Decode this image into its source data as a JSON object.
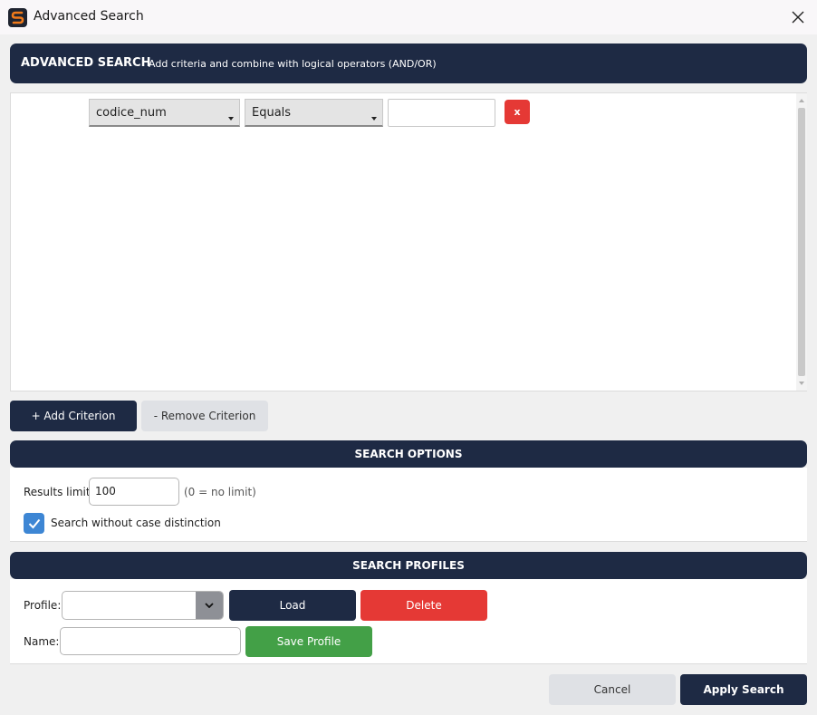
{
  "window": {
    "title": "Advanced Search"
  },
  "header": {
    "title": "ADVANCED SEARCH",
    "subtitle": "Add criteria and combine with logical operators (AND/OR)"
  },
  "criteria": {
    "rows": [
      {
        "field": "codice_num",
        "operator": "Equals",
        "value": "",
        "remove_label": "x"
      }
    ],
    "add_label": "+ Add Criterion",
    "remove_label": "- Remove Criterion"
  },
  "search_options": {
    "title": "SEARCH OPTIONS",
    "results_limit_label": "Results limit:",
    "results_limit_value": "100",
    "results_limit_hint": "(0 = no limit)",
    "case_insensitive_label": "Search without case distinction",
    "case_insensitive_checked": true
  },
  "search_profiles": {
    "title": "SEARCH PROFILES",
    "profile_label": "Profile:",
    "profile_value": "",
    "load_label": "Load",
    "delete_label": "Delete",
    "name_label": "Name:",
    "name_value": "",
    "save_label": "Save Profile"
  },
  "footer": {
    "cancel_label": "Cancel",
    "apply_label": "Apply Search"
  },
  "colors": {
    "primary_dark": "#1e2a44",
    "danger": "#e53935",
    "success": "#43a047",
    "checkbox": "#3d86d4"
  }
}
